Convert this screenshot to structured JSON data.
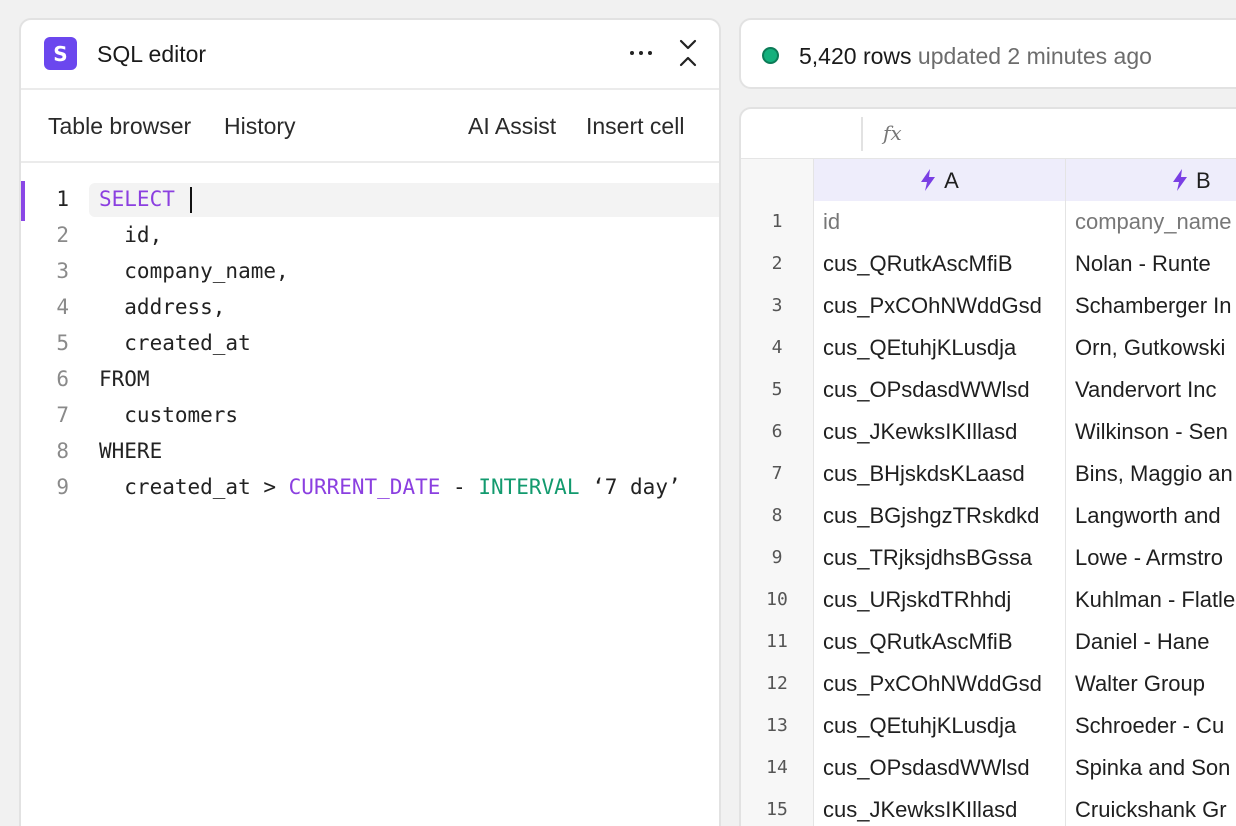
{
  "editor": {
    "logo_letter": "S",
    "title": "SQL editor",
    "tabs": {
      "table_browser": "Table browser",
      "history": "History",
      "ai_assist": "AI Assist",
      "insert_cell": "Insert cell"
    },
    "line_numbers": [
      "1",
      "2",
      "3",
      "4",
      "5",
      "6",
      "7",
      "8",
      "9"
    ],
    "code": {
      "l1": "SELECT",
      "l2": "  id,",
      "l3": "  company_name,",
      "l4": "  address,",
      "l5": "  created_at",
      "l6": "FROM",
      "l7": "  customers",
      "l8": "WHERE",
      "l9_col": "  created_at > ",
      "l9_fn": "CURRENT_DATE",
      "l9_minus": " - ",
      "l9_interval": "INTERVAL",
      "l9_val": " ‘7 day’"
    }
  },
  "status": {
    "indicator_color": "#13b07c",
    "count": "5,420 rows",
    "updated": " updated 2 minutes ago"
  },
  "sheet": {
    "formula_icon": "fx",
    "columns": [
      "A",
      "B"
    ],
    "rows": [
      {
        "n": "1",
        "a": "id",
        "b": "company_name"
      },
      {
        "n": "2",
        "a": "cus_QRutkAscMfiB",
        "b": "Nolan - Runte"
      },
      {
        "n": "3",
        "a": "cus_PxCOhNWddGsd",
        "b": "Schamberger In"
      },
      {
        "n": "4",
        "a": "cus_QEtuhjKLusdja",
        "b": "Orn, Gutkowski"
      },
      {
        "n": "5",
        "a": "cus_OPsdasdWWlsd",
        "b": "Vandervort Inc"
      },
      {
        "n": "6",
        "a": "cus_JKewksIKIllasd",
        "b": "Wilkinson - Sen"
      },
      {
        "n": "7",
        "a": "cus_BHjskdsKLaasd",
        "b": "Bins, Maggio an"
      },
      {
        "n": "8",
        "a": "cus_BGjshgzTRskdkd",
        "b": "Langworth and"
      },
      {
        "n": "9",
        "a": "cus_TRjksjdhsBGssa",
        "b": "Lowe - Armstro"
      },
      {
        "n": "10",
        "a": "cus_URjskdTRhhdj",
        "b": "Kuhlman - Flatle"
      },
      {
        "n": "11",
        "a": "cus_QRutkAscMfiB",
        "b": "Daniel - Hane"
      },
      {
        "n": "12",
        "a": "cus_PxCOhNWddGsd",
        "b": "Walter Group"
      },
      {
        "n": "13",
        "a": "cus_QEtuhjKLusdja",
        "b": "Schroeder - Cu"
      },
      {
        "n": "14",
        "a": "cus_OPsdasdWWlsd",
        "b": "Spinka and Son"
      },
      {
        "n": "15",
        "a": "cus_JKewksIKIllasd",
        "b": "Cruickshank Gr"
      }
    ]
  }
}
